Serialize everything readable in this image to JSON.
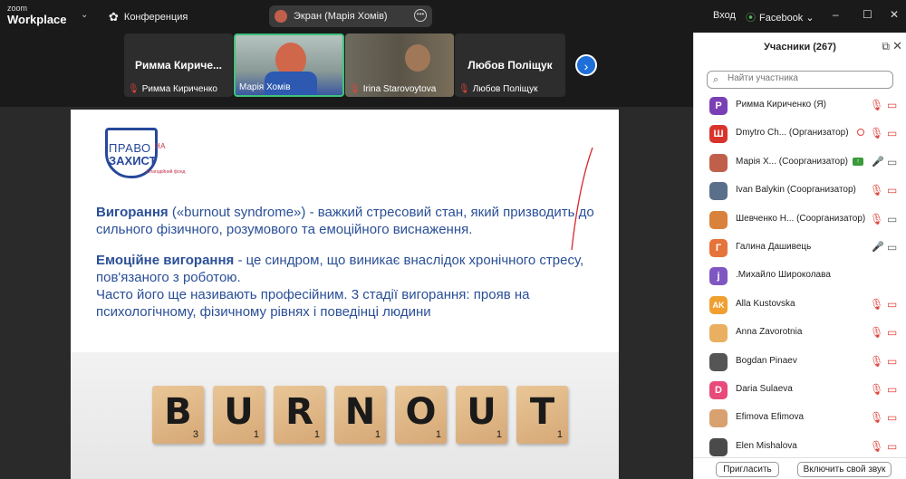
{
  "titlebar": {
    "brand_line1": "zoom",
    "brand_line2": "Workplace",
    "meeting_label": "Конференция",
    "share_pill": "Экран (Марія Хомів)",
    "login_label": "Вход",
    "network_label": "Facebook",
    "minimize": "–",
    "maximize": "☐",
    "close": "✕"
  },
  "strip": {
    "tiles": [
      {
        "name": "Римма Кириче...",
        "caption": "Римма Кириченко"
      },
      {
        "name": "",
        "caption": "Марія Хомів"
      },
      {
        "name": "",
        "caption": "Irina Starovoytova"
      },
      {
        "name": "Любов Поліщук",
        "caption": "Любов Поліщук"
      }
    ],
    "next_arrow": "›"
  },
  "slide": {
    "logo_l1": "ПРАВО",
    "logo_l1_small": "НА",
    "logo_l2": "ЗАХИСТ",
    "logo_l3": "Благодійний фонд",
    "p1_bold": "Вигорання",
    "p1_rest": " («burnout syndrome») - важкий стресовий стан, який призводить до сильного фізичного, розумового та емоційного виснаження.",
    "p2_bold": "Емоційне вигорання",
    "p2_rest": " - це синдром, що виникає внаслідок хронічного стресу, пов'язаного з роботою.",
    "p3": "Часто його ще називають професійним. 3 стадії вигорання: прояв на психологічному, фізичному рівнях і поведінці людини",
    "tiles": [
      {
        "letter": "B",
        "num": "3"
      },
      {
        "letter": "U",
        "num": "1"
      },
      {
        "letter": "R",
        "num": "1"
      },
      {
        "letter": "N",
        "num": "1"
      },
      {
        "letter": "O",
        "num": "1"
      },
      {
        "letter": "U",
        "num": "1"
      },
      {
        "letter": "T",
        "num": "1"
      }
    ]
  },
  "panel": {
    "title": "Учасники (267)",
    "search_placeholder": "Найти участника",
    "participants": [
      {
        "initial": "P",
        "color": "#7b3fb5",
        "name": "Римма Кириченко (Я)",
        "role": ""
      },
      {
        "initial": "Ш",
        "color": "#d9342b",
        "name": "Dmytro Ch...",
        "role": "(Организатор)"
      },
      {
        "initial": "",
        "color": "#c0604a",
        "name": "Марія Х...",
        "role": "(Соорганизатор)"
      },
      {
        "initial": "",
        "color": "#5a6f8a",
        "name": "Ivan Balykin",
        "role": "(Соорганизатор)"
      },
      {
        "initial": "",
        "color": "#d9823b",
        "name": "Шевченко Н...",
        "role": "(Соорганизатор)"
      },
      {
        "initial": "Г",
        "color": "#e5733a",
        "name": "Галина Дашивець",
        "role": ""
      },
      {
        "initial": "j",
        "color": "#7e57c2",
        "name": ".Михайло Широколава",
        "role": ""
      },
      {
        "initial": "AK",
        "color": "#f0a030",
        "name": "Alla Kustovska",
        "role": ""
      },
      {
        "initial": "",
        "color": "#e8b060",
        "name": "Anna Zavorotnia",
        "role": ""
      },
      {
        "initial": "",
        "color": "#555555",
        "name": "Bogdan Pinaev",
        "role": ""
      },
      {
        "initial": "D",
        "color": "#e84a7a",
        "name": "Daria Sulaeva",
        "role": ""
      },
      {
        "initial": "",
        "color": "#d9a070",
        "name": "Efimova Efimova",
        "role": ""
      },
      {
        "initial": "",
        "color": "#4a4a4a",
        "name": "Elen Mishalova",
        "role": ""
      }
    ],
    "invite_label": "Пригласить",
    "unmute_label": "Включить свой звук"
  }
}
